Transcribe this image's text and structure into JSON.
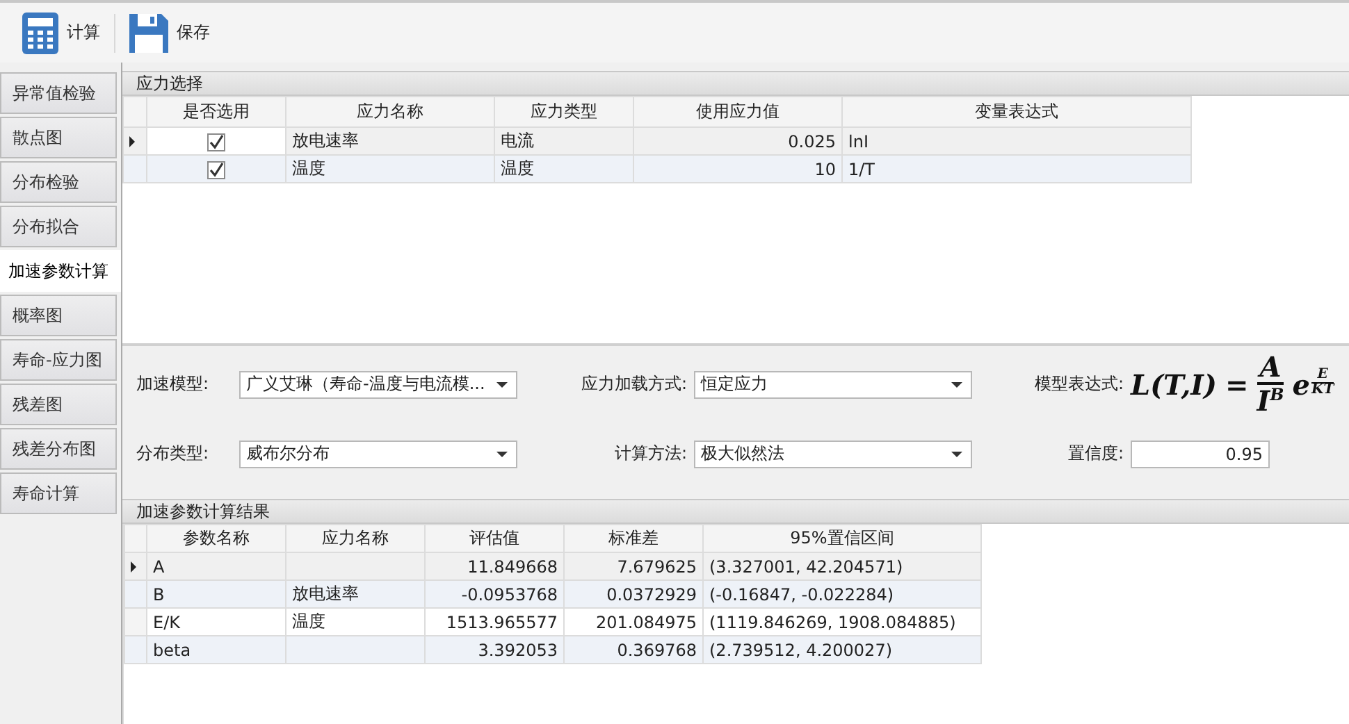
{
  "toolbar": {
    "buttons": [
      {
        "kind": "calculator",
        "label": "计算"
      },
      {
        "kind": "save",
        "label": "保存"
      }
    ]
  },
  "sidebar": {
    "items": [
      {
        "label": "异常值检验",
        "selected": false
      },
      {
        "label": "散点图",
        "selected": false
      },
      {
        "label": "分布检验",
        "selected": false
      },
      {
        "label": "分布拟合",
        "selected": false
      },
      {
        "label": "加速参数计算",
        "selected": true
      },
      {
        "label": "概率图",
        "selected": false
      },
      {
        "label": "寿命-应力图",
        "selected": false
      },
      {
        "label": "残差图",
        "selected": false
      },
      {
        "label": "残差分布图",
        "selected": false
      },
      {
        "label": "寿命计算",
        "selected": false
      }
    ]
  },
  "stress_selection": {
    "title": "应力选择",
    "columns": [
      "是否选用",
      "应力名称",
      "应力类型",
      "使用应力值",
      "变量表达式"
    ],
    "rows": [
      {
        "selected": true,
        "checked": true,
        "name": "放电速率",
        "type": "电流",
        "value": "0.025",
        "expression": "lnI"
      },
      {
        "selected": false,
        "checked": true,
        "name": "温度",
        "type": "温度",
        "value": "10",
        "expression": "1/T"
      }
    ]
  },
  "settings": {
    "model": {
      "label": "加速模型:",
      "value": "广义艾琳（寿命-温度与电流模..."
    },
    "loading": {
      "label": "应力加载方式:",
      "value": "恒定应力"
    },
    "expression": {
      "label": "模型表达式:",
      "lhs": "L(T,I)",
      "equals": "=",
      "numerator": "A",
      "base": "I",
      "base_exponent": "B",
      "e": "e",
      "exp_numerator": "E",
      "exp_denominator": "KT"
    },
    "distribution": {
      "label": "分布类型:",
      "value": "威布尔分布"
    },
    "method": {
      "label": "计算方法:",
      "value": "极大似然法"
    },
    "confidence": {
      "label": "置信度:",
      "value": "0.95"
    }
  },
  "results": {
    "title": "加速参数计算结果",
    "columns": [
      "参数名称",
      "应力名称",
      "评估值",
      "标准差",
      "95%置信区间"
    ],
    "rows": [
      {
        "selected": true,
        "cells": [
          "A",
          "",
          "11.849668",
          "7.679625",
          "(3.327001, 42.204571)"
        ]
      },
      {
        "selected": false,
        "cells": [
          "B",
          "放电速率",
          "-0.0953768",
          "0.0372929",
          "(-0.16847, -0.022284)"
        ]
      },
      {
        "selected": false,
        "cells": [
          "E/K",
          "温度",
          "1513.965577",
          "201.084975",
          "(1119.846269, 1908.084885)"
        ]
      },
      {
        "selected": false,
        "cells": [
          "beta",
          "",
          "3.392053",
          "0.369768",
          "(2.739512, 4.200027)"
        ]
      }
    ]
  }
}
